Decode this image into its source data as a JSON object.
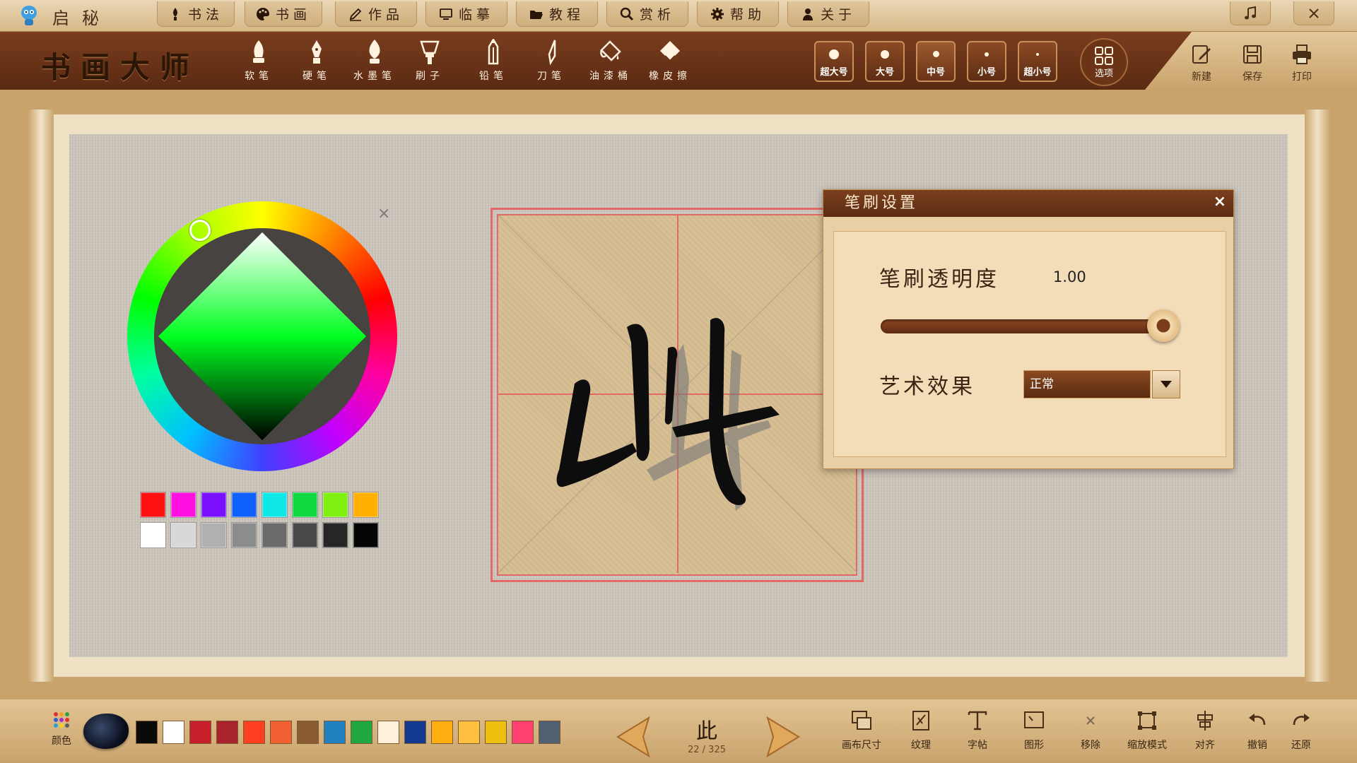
{
  "top_menu": {
    "app_brand": "启秘",
    "items": [
      "书法",
      "书画",
      "作品",
      "临摹",
      "教程",
      "赏析",
      "帮助",
      "关于"
    ]
  },
  "toolbar": {
    "app_title": "书画大师",
    "brushes": [
      "软笔",
      "硬笔",
      "水墨笔",
      "刷子",
      "铅笔",
      "刀笔",
      "油漆桶",
      "橡皮擦"
    ],
    "sizes": [
      "超大号",
      "大号",
      "中号",
      "小号",
      "超小号"
    ],
    "active_size": "中号",
    "options_label": "选项",
    "file_buttons": [
      "新建",
      "保存",
      "打印"
    ]
  },
  "color_panel": {
    "close": "×",
    "hue": "green",
    "swatches_row1": [
      "#ff1010",
      "#ff10e0",
      "#7a10ff",
      "#1060ff",
      "#10e8e8",
      "#10d840",
      "#80f010",
      "#ffb000"
    ],
    "swatches_row2": [
      "#ffffff",
      "#d8d8d8",
      "#b0b0b0",
      "#8c8c8c",
      "#6a6a6a",
      "#484848",
      "#262626",
      "#050505"
    ]
  },
  "brush_dialog": {
    "title": "笔刷设置",
    "close": "×",
    "opacity_label": "笔刷透明度",
    "opacity_value": "1.00",
    "opacity_level": 1.0,
    "effect_label": "艺术效果",
    "effect_value": "正常"
  },
  "bottom_bar": {
    "color_label": "颜色",
    "palette": [
      "#0a0a0a",
      "#ffffff",
      "#c8202a",
      "#a8232e",
      "#ff4020",
      "#f06030",
      "#8a5a30",
      "#2080c0",
      "#20a840",
      "#fff0dc",
      "#143a90",
      "#ffb010",
      "#ffc040",
      "#f0c010",
      "#ff4070",
      "#506070"
    ],
    "current_char": "此",
    "char_index": "22 / 325",
    "tools": [
      "画布尺寸",
      "纹理",
      "字帖",
      "图形",
      "移除",
      "缩放模式",
      "对齐",
      "撤销",
      "还原"
    ]
  },
  "colors": {
    "toolbar_brown": "#6b3417",
    "grid_red": "#e26a66",
    "paper": "#d8bf94"
  }
}
